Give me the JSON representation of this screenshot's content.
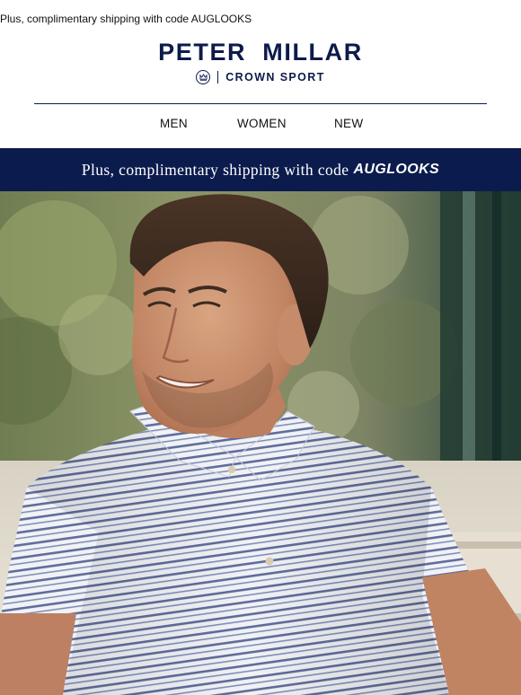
{
  "preheader": "Plus, complimentary shipping with code AUGLOOKS",
  "brand": {
    "name": "PETER MILLAR",
    "subline": "CROWN SPORT",
    "color": "#0d1b4a"
  },
  "nav": [
    "MEN",
    "WOMEN",
    "NEW"
  ],
  "banner": {
    "lead": "Plus, complimentary shipping with code",
    "code": "AUGLOOKS",
    "background": "#0c1b4d"
  },
  "hero": {
    "icon": "photo-man-striped-polo"
  }
}
